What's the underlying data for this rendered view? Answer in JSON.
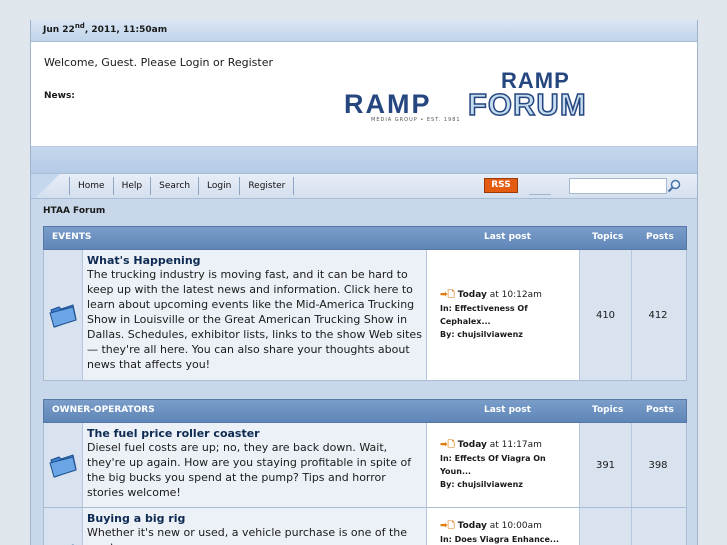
{
  "topbar": {
    "date_prefix": "Jun 22",
    "date_sup": "nd",
    "date_suffix": ", 2011, 11:50am"
  },
  "header": {
    "welcome": "Welcome, Guest. Please Login or Register",
    "news_label": "News:",
    "logo_ramp": "RAMP",
    "logo_sub": "MEDIA GROUP • EST. 1981",
    "logo_ramp2": "RAMP",
    "logo_forum": "FORUM"
  },
  "nav": {
    "items": [
      "Home",
      "Help",
      "Search",
      "Login",
      "Register"
    ],
    "rss": "RSS",
    "search_placeholder": ""
  },
  "breadcrumb": "HTAA Forum",
  "sections": [
    {
      "title": "EVENTS",
      "col_last": "Last post",
      "col_topics": "Topics",
      "col_posts": "Posts",
      "boards": [
        {
          "title": "What's Happening",
          "desc": "The trucking industry is moving fast, and it can be hard to keep up with the latest news and information. Click here to learn about upcoming events like the Mid-America Trucking Show in Louisville or the Great American Trucking Show in Dallas. Schedules, exhibitor lists, links to the show Web sites — they're all here. You can also share your thoughts about news that affects you!",
          "last_when": "Today",
          "last_time": " at 10:12am",
          "last_in": "Effectiveness Of Cephalex...",
          "last_by": "chujsilviawenz",
          "topics": "410",
          "posts": "412"
        }
      ]
    },
    {
      "title": "OWNER-OPERATORS",
      "col_last": "Last post",
      "col_topics": "Topics",
      "col_posts": "Posts",
      "boards": [
        {
          "title": "The fuel price roller coaster",
          "desc": "Diesel fuel costs are up; no, they are back down. Wait, they're up again. How are you staying profitable in spite of the big bucks you spend at the pump? Tips and horror stories welcome!",
          "last_when": "Today",
          "last_time": " at 11:17am",
          "last_in": "Effects Of Viagra On Youn...",
          "last_by": "chujsilviawenz",
          "topics": "391",
          "posts": "398"
        },
        {
          "title": "Buying a big rig",
          "desc": "Whether it's new or used, a vehicle purchase is one of the most",
          "last_when": "Today",
          "last_time": " at 10:00am",
          "last_in": "Does Viagra Enhance...",
          "last_by": "",
          "topics": "",
          "posts": ""
        }
      ]
    }
  ],
  "labels": {
    "in": "In: ",
    "by": "By: "
  },
  "colors": {
    "accent": "#5f86b8",
    "rss": "#e45c12",
    "folder": "#3c7fd0"
  }
}
